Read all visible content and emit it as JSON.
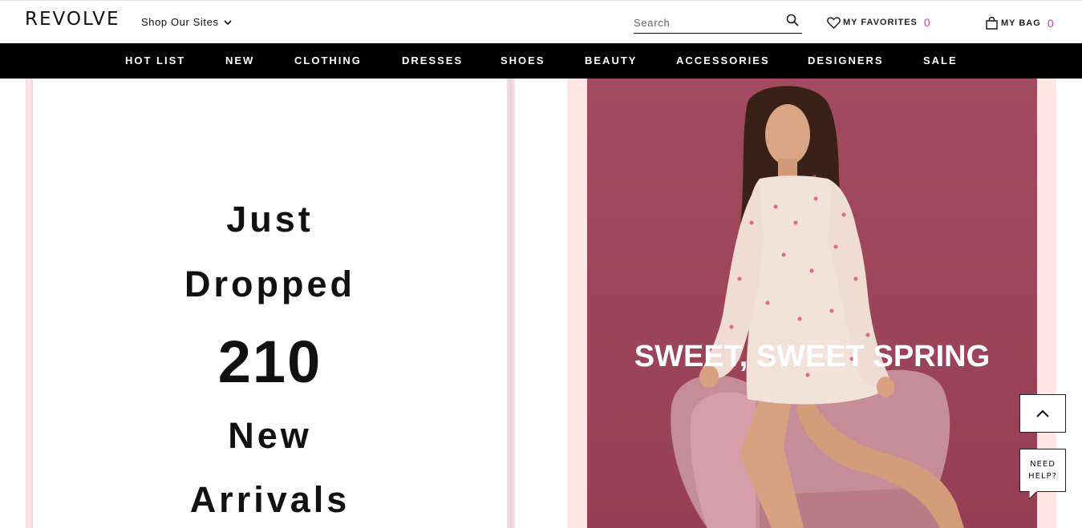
{
  "header": {
    "logo": "REVOLVE",
    "shop_sites_label": "Shop Our Sites",
    "search_placeholder": "Search",
    "favorites_label": "MY FAVORITES",
    "favorites_count": "0",
    "bag_label": "MY BAG",
    "bag_count": "0",
    "count_color": "#c2409c"
  },
  "nav": {
    "items": [
      {
        "label": "HOT LIST"
      },
      {
        "label": "NEW"
      },
      {
        "label": "CLOTHING"
      },
      {
        "label": "DRESSES"
      },
      {
        "label": "SHOES"
      },
      {
        "label": "BEAUTY"
      },
      {
        "label": "ACCESSORIES"
      },
      {
        "label": "DESIGNERS"
      },
      {
        "label": "SALE"
      }
    ]
  },
  "hero_left": {
    "line1": "Just",
    "line2": "Dropped",
    "number": "210",
    "line3": "New",
    "line4": "Arrivals"
  },
  "hero_right": {
    "promo_text": "SWEET, SWEET SPRING",
    "background_color": "#a24a5f"
  },
  "floating": {
    "scroll_top_icon": "chevron-up-icon",
    "help_line1": "NEED",
    "help_line2": "HELP?"
  }
}
